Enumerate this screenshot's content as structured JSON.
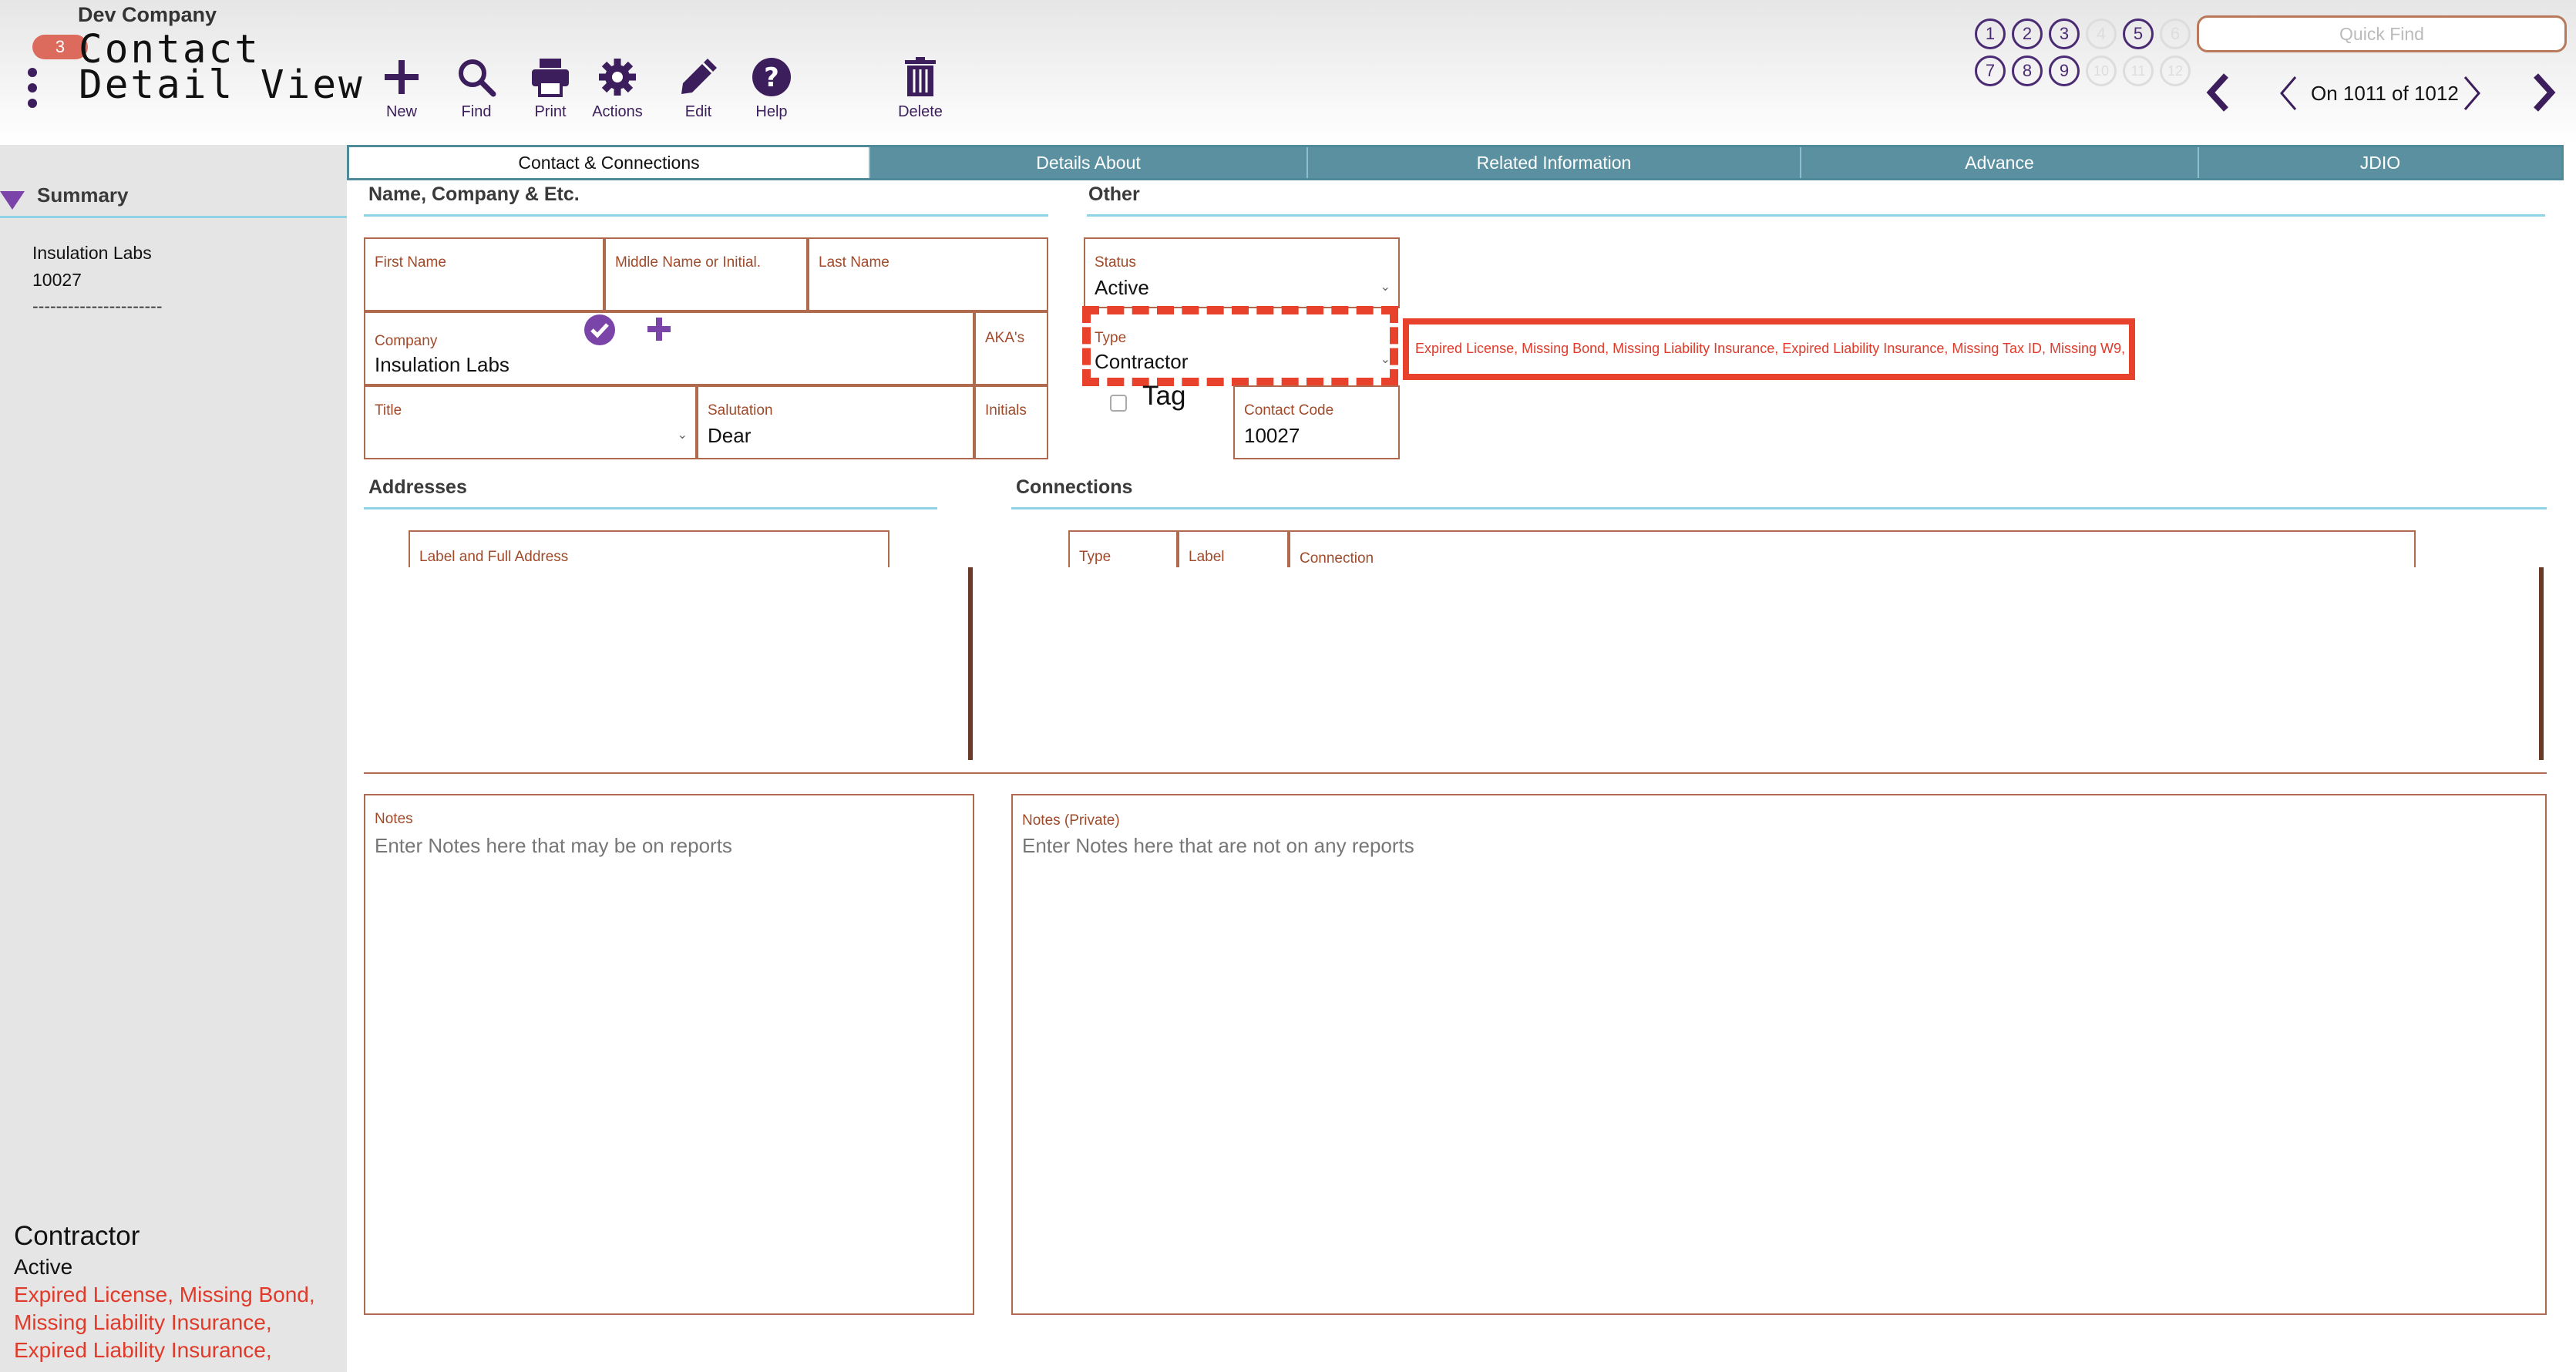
{
  "header": {
    "company": "Dev Company",
    "badge_count": "3",
    "title_line1": "Contact",
    "title_line2": "Detail View",
    "toolbar": [
      {
        "label": "New",
        "icon": "plus-icon"
      },
      {
        "label": "Find",
        "icon": "search-icon"
      },
      {
        "label": "Print",
        "icon": "printer-icon"
      },
      {
        "label": "Actions",
        "icon": "gear-icon"
      },
      {
        "label": "Edit",
        "icon": "pencil-icon"
      },
      {
        "label": "Help",
        "icon": "help-icon"
      },
      {
        "label": "Delete",
        "icon": "trash-icon"
      }
    ],
    "numbered_buttons": [
      "1",
      "2",
      "3",
      "4",
      "5",
      "6",
      "7",
      "8",
      "9",
      "10",
      "11",
      "12"
    ],
    "quick_find_placeholder": "Quick Find",
    "record_position": "On 1011 of 1012"
  },
  "sidebar": {
    "title": "Summary",
    "company": "Insulation Labs",
    "code": "10027",
    "separator": "----------------------",
    "type": "Contractor",
    "status": "Active",
    "alerts": "Expired License, Missing Bond, Missing Liability Insurance, Expired Liability Insurance,"
  },
  "tabs": [
    {
      "label": "Contact & Connections",
      "active": true
    },
    {
      "label": "Details About",
      "active": false
    },
    {
      "label": "Related Information",
      "active": false
    },
    {
      "label": "Advance",
      "active": false
    },
    {
      "label": "JDIO",
      "active": false
    }
  ],
  "name_section": {
    "title": "Name, Company & Etc.",
    "first_name_label": "First Name",
    "first_name": "",
    "middle_label": "Middle Name or Initial.",
    "middle": "",
    "last_label": "Last Name",
    "last": "",
    "company_label": "Company",
    "company": "Insulation Labs",
    "akas_label": "AKA's",
    "title_label": "Title",
    "title_value": "",
    "salutation_label": "Salutation",
    "salutation": "Dear",
    "initials_label": "Initials",
    "initials": ""
  },
  "other_section": {
    "title": "Other",
    "status_label": "Status",
    "status": "Active",
    "type_label": "Type",
    "type": "Contractor",
    "tag_label": "Tag",
    "contact_code_label": "Contact Code",
    "contact_code": "10027",
    "alert_text": "Expired License, Missing Bond, Missing Liability Insurance, Expired Liability Insurance, Missing Tax ID, Missing W9,"
  },
  "addresses": {
    "title": "Addresses",
    "column": "Label and Full Address"
  },
  "connections": {
    "title": "Connections",
    "columns": [
      "Type",
      "Label",
      "Connection"
    ]
  },
  "notes": {
    "label": "Notes",
    "placeholder": "Enter Notes here that may be on reports",
    "private_label": "Notes (Private)",
    "private_placeholder": "Enter Notes here that are not on any reports"
  },
  "colors": {
    "accent": "#3d1e5c",
    "tab_bg": "#5a909f",
    "field_border": "#b06a4e",
    "alert": "#e8412c",
    "badge": "#dc6b5e"
  }
}
